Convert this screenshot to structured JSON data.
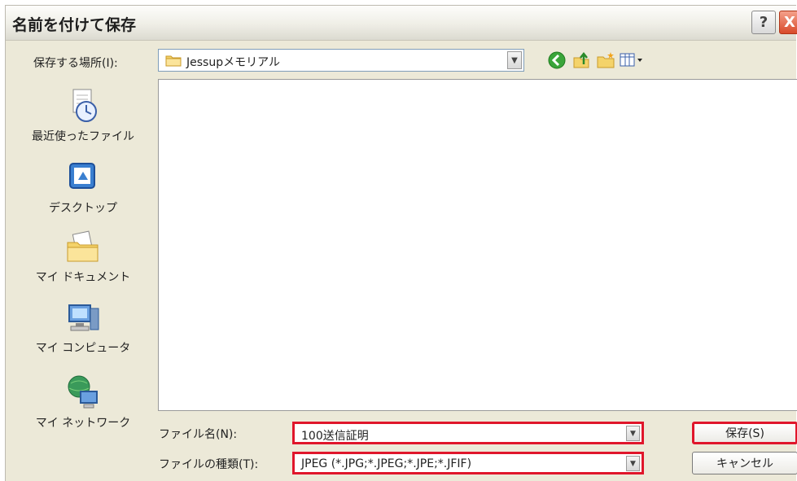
{
  "window": {
    "title": "名前を付けて保存",
    "help_glyph": "?",
    "close_glyph": "X"
  },
  "lookin": {
    "label": "保存する場所(I):",
    "value": "Jessupメモリアル"
  },
  "toolbar": {
    "icons": [
      "back-icon",
      "up-folder-icon",
      "new-folder-icon",
      "view-menu-icon"
    ]
  },
  "places": [
    {
      "label": "最近使ったファイル",
      "icon": "recent-files-icon"
    },
    {
      "label": "デスクトップ",
      "icon": "desktop-icon"
    },
    {
      "label": "マイ ドキュメント",
      "icon": "my-documents-icon"
    },
    {
      "label": "マイ コンピュータ",
      "icon": "my-computer-icon"
    },
    {
      "label": "マイ ネットワーク",
      "icon": "my-network-icon"
    }
  ],
  "filename": {
    "label": "ファイル名(N):",
    "value": "100送信証明"
  },
  "filetype": {
    "label": "ファイルの種類(T):",
    "value": "JPEG (*.JPG;*.JPEG;*.JPE;*.JFIF)"
  },
  "buttons": {
    "save": "保存(S)",
    "cancel": "キャンセル"
  },
  "colors": {
    "highlight": "#e0162b",
    "dialog_bg": "#ece9d8"
  }
}
